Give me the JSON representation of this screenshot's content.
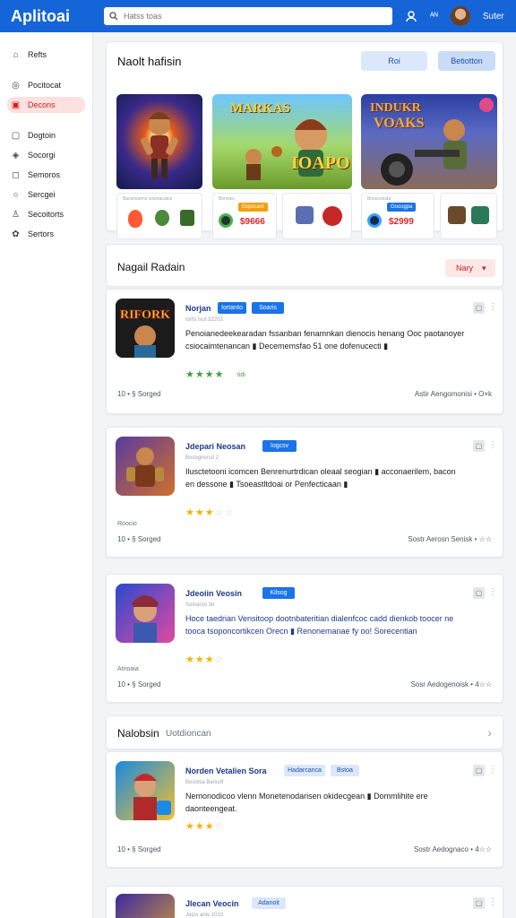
{
  "header": {
    "logo": "Aplitoai",
    "search_placeholder": "Hatss toas",
    "icon_label": "ᴬᴺ",
    "user_name": "Suter"
  },
  "sidebar": {
    "items": [
      {
        "label": "Refts",
        "icon": "home-icon"
      },
      {
        "label": "Pocitocat",
        "icon": "podcast-icon"
      },
      {
        "label": "Decons",
        "icon": "book-icon",
        "active": true
      },
      {
        "label": "Dogtoin",
        "icon": "document-icon"
      },
      {
        "label": "Socorgi",
        "icon": "gamepad-icon"
      },
      {
        "label": "Semoros",
        "icon": "message-icon"
      },
      {
        "label": "Sercgei",
        "icon": "search-icon"
      },
      {
        "label": "Secoitorts",
        "icon": "user-icon"
      },
      {
        "label": "Sertors",
        "icon": "settings-icon"
      }
    ]
  },
  "featured": {
    "title": "Naolt hafisin",
    "btn_primary": "Roi",
    "btn_secondary": "Betiotton",
    "cards": [
      {
        "art_text": ""
      },
      {
        "art_text": "MARKAS",
        "art_text2": "IOAPO"
      },
      {
        "art_text": "INDUKR",
        "art_text2": "VOAKS"
      }
    ],
    "minis": [
      {
        "caption": "Baconsseno tsisotacatos",
        "price": ""
      },
      {
        "caption": "Bomsoc",
        "tag": "Elqoicant",
        "price": "$9666"
      },
      {
        "caption": "Bosoconsta",
        "tag": "Goosgpa",
        "price": "$2999"
      }
    ]
  },
  "list": {
    "title": "Nagail Radain",
    "sort_label": "Nary",
    "apps": [
      {
        "title": "Norjan",
        "badge1": "Iortanto",
        "badge2": "Soaris",
        "sub": "Iorfo Isut 32203",
        "desc": "Penoianedeekearadan fssanban fenamnkan dienocis henang Ooc paotanoyer csiocaimtenancan ▮ Decememsfao 51 one dofenucecti ▮",
        "rating": 4,
        "stars_green": true,
        "rating_tag": "tidi",
        "tag_note": "",
        "foot_left": "10 • § Sorged",
        "foot_right": "Astir Aengomonisi • O×k"
      },
      {
        "title": "Jdepari Neosan",
        "badge1": "Iogcsv",
        "badge2": "",
        "sub": "Bosognersd 2",
        "desc": "Ilusctetooni icomcen Benrenurtrdican oleaal seogian ▮ acconaerilem, bacon en dessone ▮ Tsoeastltdoai or Penfecticaan ▮",
        "rating": 3,
        "stars_green": false,
        "rating_tag": "",
        "tag_note": "Roocio",
        "foot_left": "10 • § Sorged",
        "foot_right": "Sostr Aerosn Senisk • ☆☆"
      },
      {
        "title": "Jdeoiin Veosin",
        "badge1": "Kilsog",
        "badge2": "",
        "sub": "Soinaroo 3e",
        "desc": "Hoce taedrian Vensitoop dootnbateritian dialenfcoc cadd dienkob toocer ne tooca tsoponcortikcen Orecn ▮ Renonemanae fy oo! Sorecentian",
        "rating": 3,
        "stars_green": false,
        "rating_tag": "",
        "tag_note": "Atnoaia",
        "foot_left": "10 • § Sorged",
        "foot_right": "Sosr Aedogenoisk • 4☆☆"
      }
    ]
  },
  "second": {
    "title": "Nalobsin",
    "subtitle": "Uotdioncan",
    "apps": [
      {
        "title": "Norden Vetalien Sora",
        "badge1": "Hadarcanca",
        "badge2": "Bstoa",
        "sub": "Bosotsa Banodf",
        "desc": "Nemonodicoo vlenn Monetenodarisen okidecgean ▮ Dommlihite ere daonteengeat.",
        "rating": 3,
        "foot_left": "10 • § Sorged",
        "foot_right": "Sostr Aedognaco • 4☆☆"
      },
      {
        "title": "Jlecan Veocin",
        "badge1": "Adanoit",
        "sub": "Jotzo anis 1010"
      }
    ]
  }
}
